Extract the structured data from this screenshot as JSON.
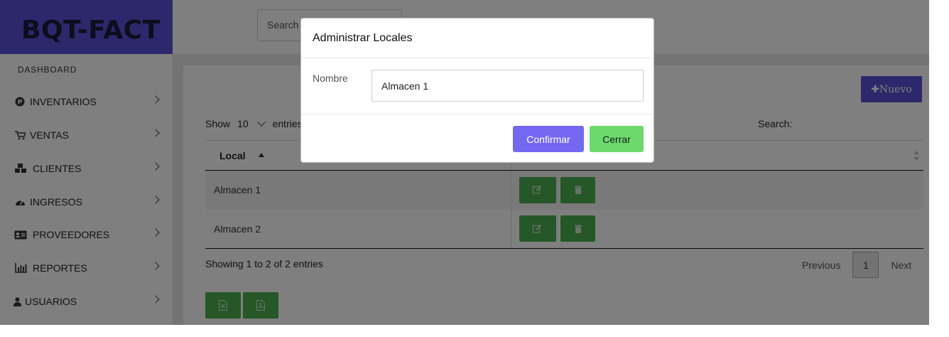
{
  "brand": "BQT-FACT",
  "sidebar": {
    "dashboard": "DASHBOARD",
    "items": [
      {
        "label": "INVENTARIOS",
        "icon": "p-circle-icon"
      },
      {
        "label": "VENTAS",
        "icon": "cart-icon"
      },
      {
        "label": "CLIENTES",
        "icon": "cubes-icon"
      },
      {
        "label": "INGRESOS",
        "icon": "gauge-icon"
      },
      {
        "label": "PROVEEDORES",
        "icon": "id-card-icon"
      },
      {
        "label": "REPORTES",
        "icon": "bar-chart-icon"
      },
      {
        "label": "USUARIOS",
        "icon": "user-icon"
      }
    ]
  },
  "topbar": {
    "search_placeholder": "Search"
  },
  "toolbar": {
    "new_label": "✚Nuevo"
  },
  "table_controls": {
    "show_label": "Show",
    "page_size": "10",
    "entries_label": "entries",
    "search_label": "Search:"
  },
  "table": {
    "columns": [
      "Local",
      ""
    ],
    "rows": [
      {
        "local": "Almacen 1"
      },
      {
        "local": "Almacen 2"
      }
    ]
  },
  "footer": {
    "info": "Showing 1 to 2 of 2 entries",
    "previous": "Previous",
    "current_page": "1",
    "next": "Next"
  },
  "modal": {
    "title": "Administrar Locales",
    "field_label": "Nombre",
    "field_value": "Almacen 1",
    "confirm": "Confirmar",
    "close": "Cerrar"
  },
  "colors": {
    "brand": "#5b50d6",
    "action_green": "#4caf50",
    "confirm": "#7468f0",
    "close": "#6bd96b"
  }
}
